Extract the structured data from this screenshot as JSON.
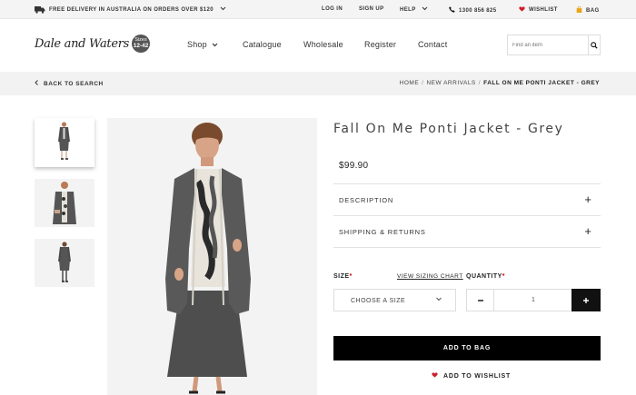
{
  "topbar": {
    "promo": "FREE DELIVERY IN AUSTRALIA ON ORDERS OVER $120",
    "login": "LOG IN",
    "signup": "SIGN UP",
    "help": "HELP",
    "phone": "1300 856 825",
    "wishlist": "WISHLIST",
    "bag": "BAG"
  },
  "header": {
    "logo_text": "Dale and Waters",
    "logo_badge_line1": "Sizes",
    "logo_badge_line2": "12-42",
    "nav": [
      "Shop",
      "Catalogue",
      "Wholesale",
      "Register",
      "Contact"
    ],
    "search_placeholder": "Find an item"
  },
  "breadcrumb": {
    "back": "BACK TO SEARCH",
    "items": [
      "HOME",
      "NEW ARRIVALS",
      "FALL ON ME PONTI JACKET - GREY"
    ]
  },
  "product": {
    "title": "Fall On Me Ponti Jacket - Grey",
    "price": "$99.90",
    "accordion": [
      "DESCRIPTION",
      "SHIPPING & RETURNS"
    ],
    "size_label": "SIZE",
    "size_chart": "VIEW SIZING CHART",
    "quantity_label": "QUANTITY",
    "size_value": "CHOOSE A SIZE",
    "quantity_value": "1",
    "add_to_bag": "ADD TO BAG",
    "add_to_wishlist": "ADD TO WISHLIST"
  },
  "icons": {
    "truck": "truck-icon",
    "phone": "phone-icon",
    "heart": "heart-icon",
    "bag": "bag-icon",
    "search": "search-icon"
  },
  "colors": {
    "accent_black": "#000000",
    "wishlist_heart": "#cc1f2a",
    "bag_icon": "#e8a317",
    "required_star": "#cc0000"
  }
}
